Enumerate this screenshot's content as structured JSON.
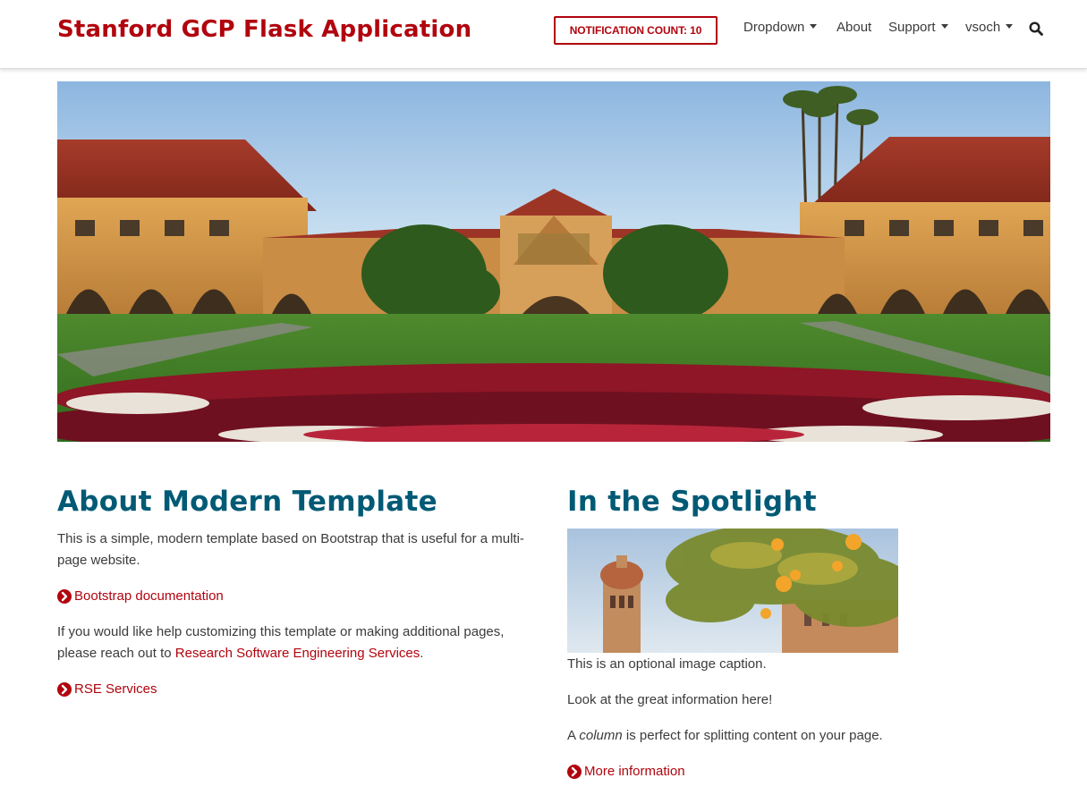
{
  "header": {
    "brand": "Stanford GCP Flask Application",
    "notification_label": "NOTIFICATION COUNT: 10",
    "nav": [
      {
        "label": "Dropdown",
        "has_caret": true
      },
      {
        "label": "About",
        "has_caret": false
      },
      {
        "label": "Support",
        "has_caret": true
      },
      {
        "label": "vsoch",
        "has_caret": true
      }
    ],
    "search_icon": "search-icon"
  },
  "hero": {
    "image_subject": "Stanford Main Quad with Memorial Church"
  },
  "about": {
    "heading": "About Modern Template",
    "intro": "This is a simple, modern template based on Bootstrap that is useful for a multi-page website.",
    "link1": "Bootstrap documentation",
    "help_text_before": "If you would like help customizing this template or making additional pages, please reach out to ",
    "help_link": "Research Software Engineering Services",
    "help_text_after": ".",
    "link2": "RSE Services"
  },
  "spotlight": {
    "heading": "In the Spotlight",
    "caption": "This is an optional image caption.",
    "line1": "Look at the great information here!",
    "line2_a": "A ",
    "line2_em": "column",
    "line2_b": " is perfect for splitting content on your page.",
    "link": "More information"
  },
  "colors": {
    "brand_red": "#b1040e",
    "heading_teal": "#005a75",
    "text": "#3b3b3b"
  }
}
